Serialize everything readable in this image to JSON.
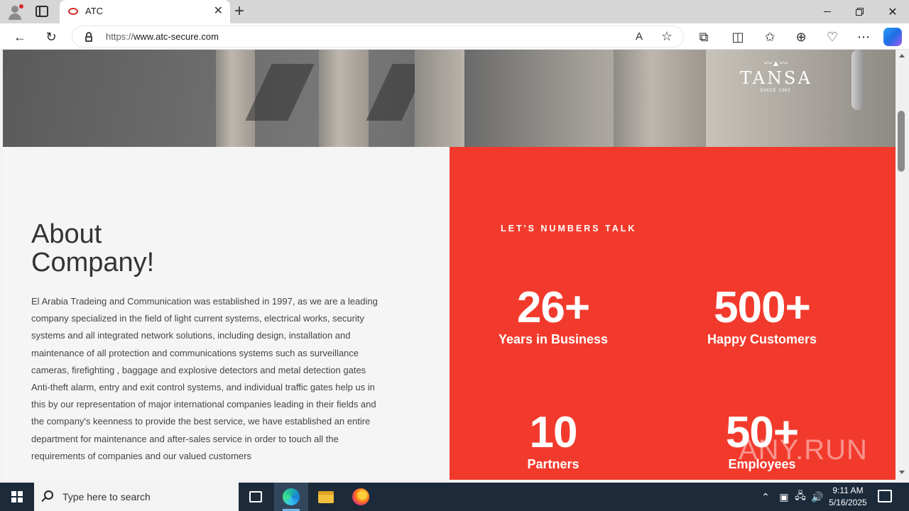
{
  "browser": {
    "tab_title": "ATC",
    "tab_close": "✕",
    "new_tab": "+",
    "url_scheme": "https://",
    "url_host": "www.atc-secure.com",
    "icons": [
      "back-icon",
      "refresh-icon",
      "lock-icon",
      "read-aloud-icon",
      "favorite-star-icon",
      "extensions-icon",
      "split-screen-icon",
      "favorites-icon",
      "collections-icon",
      "browser-essentials-icon",
      "more-icon",
      "copilot-icon"
    ]
  },
  "hero": {
    "logo_name": "TANSA",
    "logo_since": "SINCE 1962"
  },
  "about": {
    "title_line1": "About",
    "title_line2": "Company!",
    "body": "El Arabia Tradeing and Communication was established in 1997, as we  are a leading company specialized in the field of light current systems, electrical works, security systems and all integrated network solutions, including design, installation and maintenance of all protection and communications systems such as surveillance cameras, firefighting , baggage and explosive detectors and metal detection gates Anti-theft alarm, entry and exit control systems, and individual traffic gates help us in this by our representation of major  international companies leading in their fields and the company's keenness to provide the best service, we have established an entire department for maintenance and after-sales service in order to touch all the requirements of companies and our valued customers"
  },
  "stats": {
    "heading": "LET'S NUMBERS TALK",
    "items": [
      {
        "number": "26+",
        "label": "Years in Business"
      },
      {
        "number": "500+",
        "label": "Happy Customers"
      },
      {
        "number": "10",
        "label": "Partners"
      },
      {
        "number": "50+",
        "label": "Employees"
      }
    ],
    "accent_color": "#f23a2c"
  },
  "watermark": "ANY.RUN",
  "taskbar": {
    "search_placeholder": "Type here to search",
    "time": "9:11 AM",
    "date": "5/16/2025"
  }
}
